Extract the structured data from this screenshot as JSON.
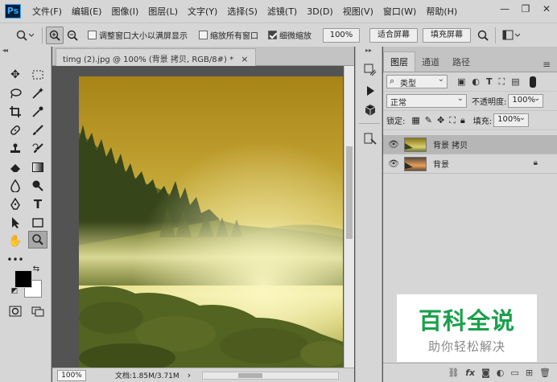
{
  "app": {
    "logo": "Ps"
  },
  "menu": [
    "文件(F)",
    "编辑(E)",
    "图像(I)",
    "图层(L)",
    "文字(Y)",
    "选择(S)",
    "滤镜(T)",
    "3D(D)",
    "视图(V)",
    "窗口(W)",
    "帮助(H)"
  ],
  "window_controls": {
    "minimize": "—",
    "restore": "❐",
    "close": "✕"
  },
  "options": {
    "resize_windows_label": "调整窗口大小以满屏显示",
    "zoom_all_label": "缩放所有窗口",
    "scrubby_zoom_label": "细微缩放",
    "zoom_value": "100%",
    "fit_screen_label": "适合屏幕",
    "fill_screen_label": "填充屏幕",
    "scrubby_checked": true
  },
  "document": {
    "tab_title": "timg (2).jpg @ 100% (背景 拷贝, RGB/8#) *",
    "close": "×"
  },
  "status": {
    "zoom": "100%",
    "doc_info": "文档:1.85M/3.71M",
    "arrow": "›"
  },
  "panel": {
    "tabs": [
      "图层",
      "通道",
      "路径"
    ],
    "filter_kind": "类型",
    "blend_mode": "正常",
    "opacity_label": "不透明度:",
    "opacity_value": "100%",
    "lock_label": "锁定:",
    "fill_label": "填充:",
    "fill_value": "100%",
    "layers": [
      {
        "name": "背景 拷贝",
        "selected": true,
        "locked": false
      },
      {
        "name": "背景",
        "selected": false,
        "locked": true
      }
    ],
    "bottom_icons": [
      "fx"
    ]
  },
  "watermark": {
    "title": "百科全说",
    "subtitle": "助你轻松解决"
  }
}
